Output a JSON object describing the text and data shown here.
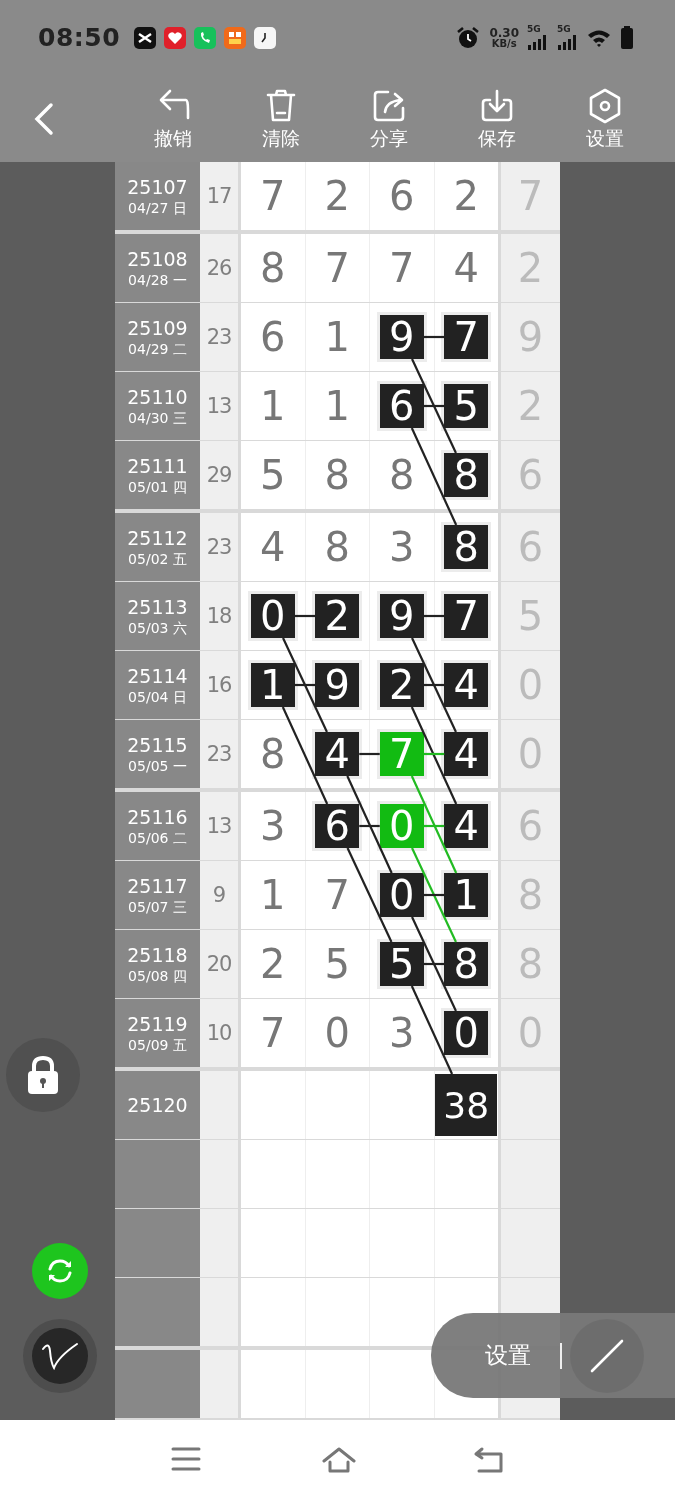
{
  "status_bar": {
    "time": "08:50",
    "net_speed": "0.30",
    "net_speed_unit": "KB/s",
    "network_labels": [
      "5G",
      "5G"
    ]
  },
  "toolbar": {
    "items": [
      {
        "label": "撤销",
        "kind": "undo"
      },
      {
        "label": "清除",
        "kind": "clear"
      },
      {
        "label": "分享",
        "kind": "share"
      },
      {
        "label": "保存",
        "kind": "save"
      },
      {
        "label": "设置",
        "kind": "settings"
      }
    ]
  },
  "groups": [
    {
      "rows": [
        {
          "issue": "25107",
          "date": "04/27 日",
          "sum": "17",
          "digits": [
            {
              "text": "7",
              "highlighted": false
            },
            {
              "text": "2",
              "highlighted": false
            },
            {
              "text": "6",
              "highlighted": false
            },
            {
              "text": "2",
              "highlighted": false
            }
          ],
          "last_column": "7"
        }
      ]
    },
    {
      "rows": [
        {
          "issue": "25108",
          "date": "04/28 一",
          "sum": "26",
          "digits": [
            {
              "text": "8",
              "highlighted": false
            },
            {
              "text": "7",
              "highlighted": false
            },
            {
              "text": "7",
              "highlighted": false
            },
            {
              "text": "4",
              "highlighted": false
            }
          ],
          "last_column": "2"
        },
        {
          "issue": "25109",
          "date": "04/29 二",
          "sum": "23",
          "digits": [
            {
              "text": "6",
              "highlighted": false
            },
            {
              "text": "1",
              "highlighted": false
            },
            {
              "text": "9",
              "highlighted": true,
              "color": "#222222",
              "line_right": {
                "color": "#222222"
              },
              "line_diagonal": {
                "color": "#222222"
              }
            },
            {
              "text": "7",
              "highlighted": true,
              "color": "#222222"
            }
          ],
          "last_column": "9"
        },
        {
          "issue": "25110",
          "date": "04/30 三",
          "sum": "13",
          "digits": [
            {
              "text": "1",
              "highlighted": false
            },
            {
              "text": "1",
              "highlighted": false
            },
            {
              "text": "6",
              "highlighted": true,
              "color": "#222222",
              "line_right": {
                "color": "#222222"
              },
              "line_diagonal": {
                "color": "#222222"
              }
            },
            {
              "text": "5",
              "highlighted": true,
              "color": "#222222"
            }
          ],
          "last_column": "2"
        },
        {
          "issue": "25111",
          "date": "05/01 四",
          "sum": "29",
          "digits": [
            {
              "text": "5",
              "highlighted": false
            },
            {
              "text": "8",
              "highlighted": false
            },
            {
              "text": "8",
              "highlighted": false
            },
            {
              "text": "8",
              "highlighted": true,
              "color": "#222222"
            }
          ],
          "last_column": "6"
        }
      ]
    },
    {
      "rows": [
        {
          "issue": "25112",
          "date": "05/02 五",
          "sum": "23",
          "digits": [
            {
              "text": "4",
              "highlighted": false
            },
            {
              "text": "8",
              "highlighted": false
            },
            {
              "text": "3",
              "highlighted": false
            },
            {
              "text": "8",
              "highlighted": true,
              "color": "#222222"
            }
          ],
          "last_column": "6"
        },
        {
          "issue": "25113",
          "date": "05/03 六",
          "sum": "18",
          "digits": [
            {
              "text": "0",
              "highlighted": true,
              "color": "#222222",
              "line_right": {
                "color": "#222222"
              },
              "line_diagonal": {
                "color": "#222222"
              }
            },
            {
              "text": "2",
              "highlighted": true,
              "color": "#222222"
            },
            {
              "text": "9",
              "highlighted": true,
              "color": "#222222",
              "line_right": {
                "color": "#222222"
              },
              "line_diagonal": {
                "color": "#222222"
              }
            },
            {
              "text": "7",
              "highlighted": true,
              "color": "#222222"
            }
          ],
          "last_column": "5"
        },
        {
          "issue": "25114",
          "date": "05/04 日",
          "sum": "16",
          "digits": [
            {
              "text": "1",
              "highlighted": true,
              "color": "#222222",
              "line_right": {
                "color": "#222222"
              },
              "line_diagonal": {
                "color": "#222222"
              }
            },
            {
              "text": "9",
              "highlighted": true,
              "color": "#222222"
            },
            {
              "text": "2",
              "highlighted": true,
              "color": "#222222",
              "line_right": {
                "color": "#222222"
              },
              "line_diagonal": {
                "color": "#222222"
              }
            },
            {
              "text": "4",
              "highlighted": true,
              "color": "#222222"
            }
          ],
          "last_column": "0"
        },
        {
          "issue": "25115",
          "date": "05/05 一",
          "sum": "23",
          "digits": [
            {
              "text": "8",
              "highlighted": false
            },
            {
              "text": "4",
              "highlighted": true,
              "color": "#222222",
              "line_right": {
                "color": "#222222"
              },
              "line_diagonal": {
                "color": "#222222"
              }
            },
            {
              "text": "7",
              "highlighted": true,
              "color": "#12bb12",
              "line_right": {
                "color": "#22bb22"
              },
              "line_diagonal": {
                "color": "#22bb22"
              }
            },
            {
              "text": "4",
              "highlighted": true,
              "color": "#222222"
            }
          ],
          "last_column": "0"
        }
      ]
    },
    {
      "rows": [
        {
          "issue": "25116",
          "date": "05/06 二",
          "sum": "13",
          "digits": [
            {
              "text": "3",
              "highlighted": false
            },
            {
              "text": "6",
              "highlighted": true,
              "color": "#222222",
              "line_right": {
                "color": "#222222"
              },
              "line_diagonal": {
                "color": "#222222"
              }
            },
            {
              "text": "0",
              "highlighted": true,
              "color": "#12bb12",
              "line_right": {
                "color": "#22bb22"
              },
              "line_diagonal": {
                "color": "#22bb22"
              }
            },
            {
              "text": "4",
              "highlighted": true,
              "color": "#222222"
            }
          ],
          "last_column": "6"
        },
        {
          "issue": "25117",
          "date": "05/07 三",
          "sum": "9",
          "digits": [
            {
              "text": "1",
              "highlighted": false
            },
            {
              "text": "7",
              "highlighted": false
            },
            {
              "text": "0",
              "highlighted": true,
              "color": "#222222",
              "line_right": {
                "color": "#222222"
              },
              "line_diagonal": {
                "color": "#222222"
              }
            },
            {
              "text": "1",
              "highlighted": true,
              "color": "#222222"
            }
          ],
          "last_column": "8"
        },
        {
          "issue": "25118",
          "date": "05/08 四",
          "sum": "20",
          "digits": [
            {
              "text": "2",
              "highlighted": false
            },
            {
              "text": "5",
              "highlighted": false
            },
            {
              "text": "5",
              "highlighted": true,
              "color": "#222222",
              "line_right": {
                "color": "#222222"
              },
              "line_diagonal": {
                "color": "#222222"
              }
            },
            {
              "text": "8",
              "highlighted": true,
              "color": "#222222"
            }
          ],
          "last_column": "8"
        },
        {
          "issue": "25119",
          "date": "05/09 五",
          "sum": "10",
          "digits": [
            {
              "text": "7",
              "highlighted": false
            },
            {
              "text": "0",
              "highlighted": false
            },
            {
              "text": "3",
              "highlighted": false
            },
            {
              "text": "0",
              "highlighted": true,
              "color": "#222222"
            }
          ],
          "last_column": "0"
        }
      ]
    },
    {
      "rows": [
        {
          "issue": "25120",
          "prediction": {
            "text": "38",
            "highlighted": true,
            "color": "#222222"
          }
        }
      ]
    }
  ],
  "floating_panel": {
    "label": "设置"
  }
}
